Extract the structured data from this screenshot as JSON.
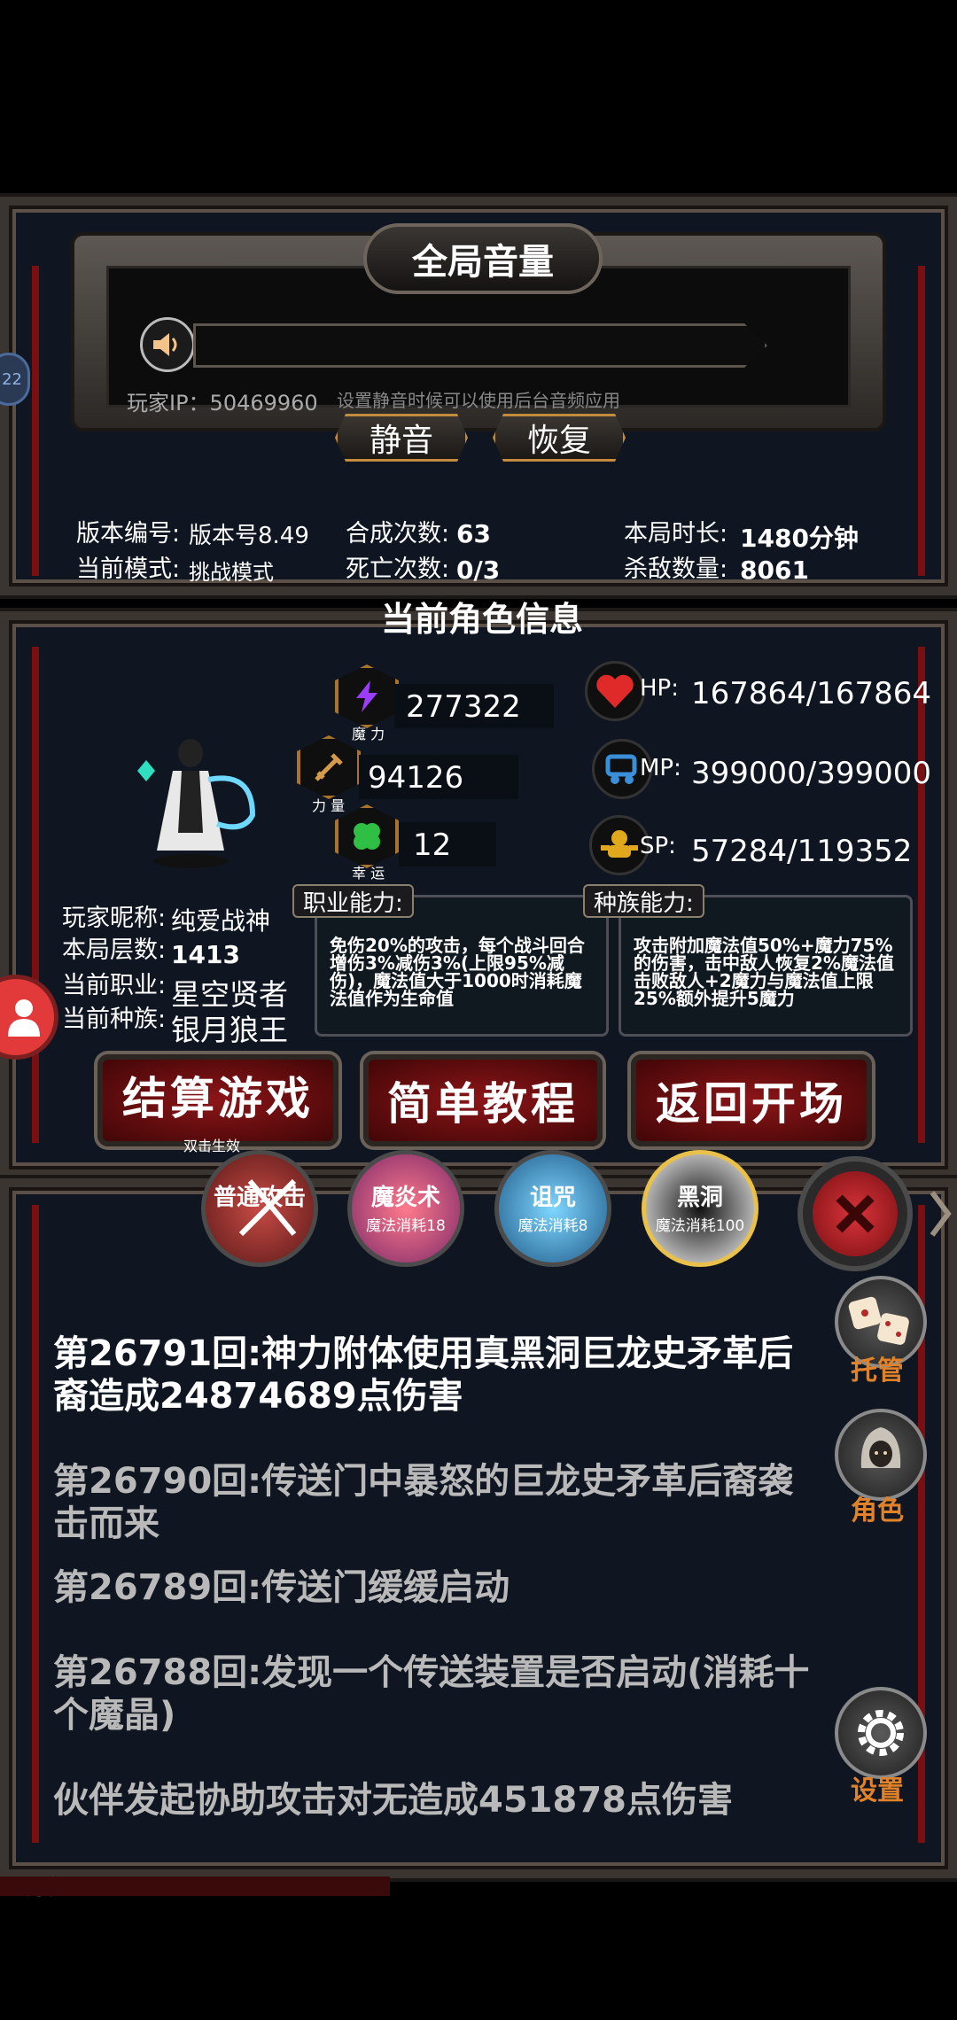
{
  "colors": {
    "accent_gold": "#c28b3d",
    "button_red": "#8c1518",
    "log_current": "#ffffff",
    "log_past": "#b9b9b9",
    "side_label_orange": "#e0822a",
    "hp_heart": "#e02a2a",
    "luck_clover": "#2fbf44"
  },
  "volume_panel": {
    "title": "全局音量",
    "speaker_icon": "speaker-icon",
    "player_ip": "玩家IP：50469960",
    "hint": "设置静音时候可以使用后台音频应用",
    "mute_label": "静音",
    "restore_label": "恢复"
  },
  "game_stats": {
    "version_label": "版本编号:",
    "version_value": "版本号8.49",
    "mode_label": "当前模式:",
    "mode_value": "挑战模式",
    "synth_label": "合成次数:",
    "synth_value": "63",
    "death_label": "死亡次数:",
    "death_value": "0/3",
    "duration_label": "本局时长:",
    "duration_value": "1480分钟",
    "kills_label": "杀敌数量:",
    "kills_value": "8061"
  },
  "character": {
    "section_title": "当前角色信息",
    "magic_value": "277322",
    "magic_caption": "魔 力",
    "strength_value": "94126",
    "strength_caption": "力 量",
    "luck_value": "12",
    "luck_caption": "幸 运",
    "hp_label": "HP:",
    "hp_value": "167864/167864",
    "mp_label": "MP:",
    "mp_value": "399000/399000",
    "sp_label": "SP:",
    "sp_value": "57284/119352",
    "nickname_label": "玩家昵称:",
    "nickname_value": "纯爱战神",
    "floor_label": "本局层数:",
    "floor_value": "1413",
    "class_label": "当前职业:",
    "class_value": "星空贤者",
    "race_label": "当前种族:",
    "race_value": "银月狼王",
    "class_ability_title": "职业能力:",
    "class_ability_text": "免伤20%的攻击，每个战斗回合增伤3%减伤3%(上限95%减伤)，魔法值大于1000时消耗魔法值作为生命值",
    "race_ability_title": "种族能力:",
    "race_ability_text": "攻击附加魔法值50%+魔力75%的伤害，击中敌人恢复2%魔法值击败敌人+2魔力与魔法值上限25%额外提升5魔力"
  },
  "actions": {
    "settle_label": "结算游戏",
    "settle_hint": "双击生效",
    "tutorial_label": "简单教程",
    "return_label": "返回开场"
  },
  "skills": [
    {
      "name": "普通攻击",
      "cost": ""
    },
    {
      "name": "魔炎术",
      "cost": "魔法消耗18"
    },
    {
      "name": "诅咒",
      "cost": "魔法消耗8"
    },
    {
      "name": "黑洞",
      "cost": "魔法消耗100"
    }
  ],
  "side_buttons": {
    "auto_label": "托管",
    "role_label": "角色",
    "settings_label": "设置"
  },
  "battle_log": [
    {
      "text": "第26791回:神力附体使用真黑洞巨龙史矛革后裔造成24874689点伤害"
    },
    {
      "text": "第26790回:传送门中暴怒的巨龙史矛革后裔袭击而来"
    },
    {
      "text": "第26789回:传送门缓缓启动"
    },
    {
      "text": "第26788回:发现一个传送装置是否启动(消耗十个魔晶)"
    },
    {
      "text": "伙伴发起协助攻击对无造成451878点伤害"
    }
  ],
  "footer": {
    "player_ip": "玩家IP：50469960"
  },
  "edge_badge": "22"
}
